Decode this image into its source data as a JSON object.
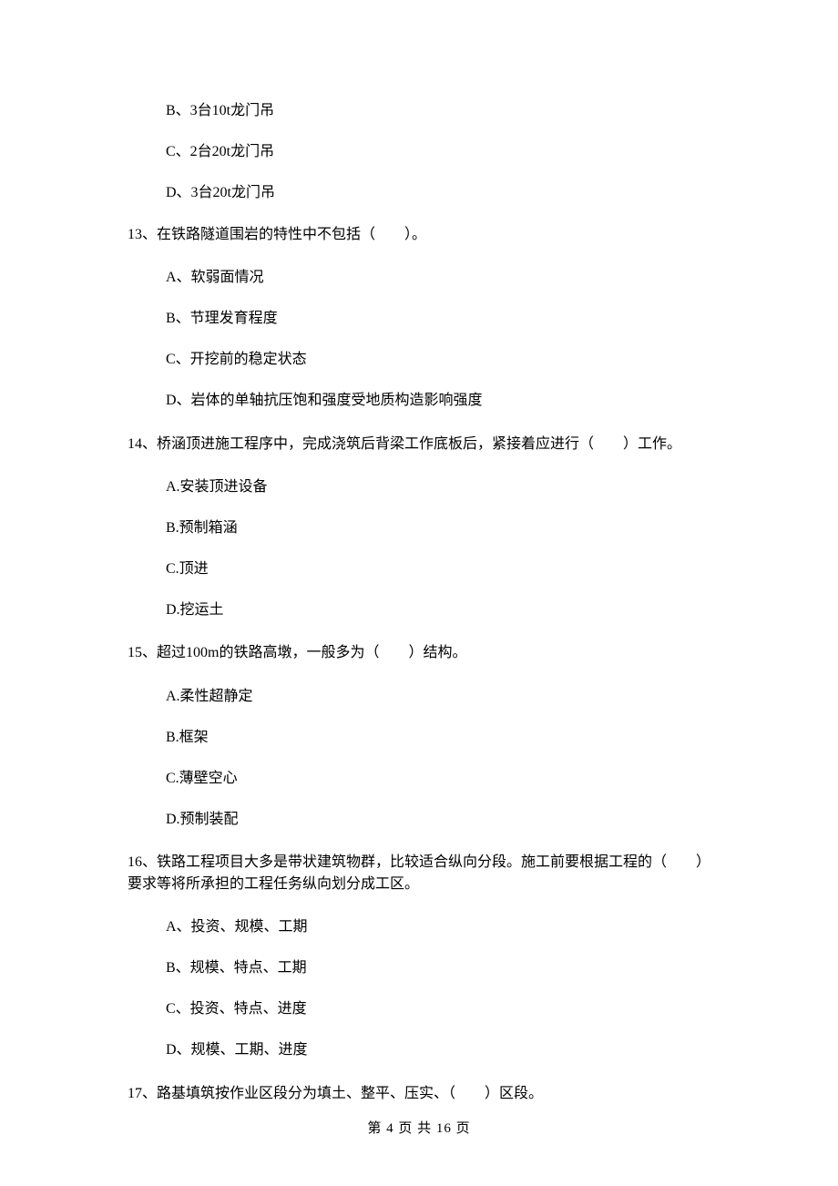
{
  "orphan_options": {
    "b": "B、3台10t龙门吊",
    "c": "C、2台20t龙门吊",
    "d": "D、3台20t龙门吊"
  },
  "q13": {
    "text": "13、在铁路隧道围岩的特性中不包括（　　）。",
    "a": "A、软弱面情况",
    "b": "B、节理发育程度",
    "c": "C、开挖前的稳定状态",
    "d": "D、岩体的单轴抗压饱和强度受地质构造影响强度"
  },
  "q14": {
    "text": "14、桥涵顶进施工程序中，完成浇筑后背梁工作底板后，紧接着应进行（　　）工作。",
    "a": "A.安装顶进设备",
    "b": "B.预制箱涵",
    "c": "C.顶进",
    "d": "D.挖运土"
  },
  "q15": {
    "text": "15、超过100m的铁路高墩，一般多为（　　）结构。",
    "a": "A.柔性超静定",
    "b": "B.框架",
    "c": "C.薄壁空心",
    "d": "D.预制装配"
  },
  "q16": {
    "text": "16、铁路工程项目大多是带状建筑物群，比较适合纵向分段。施工前要根据工程的（　　）要求等将所承担的工程任务纵向划分成工区。",
    "a": "A、投资、规模、工期",
    "b": "B、规模、特点、工期",
    "c": "C、投资、特点、进度",
    "d": "D、规模、工期、进度"
  },
  "q17": {
    "text": "17、路基填筑按作业区段分为填土、整平、压实、（　　）区段。"
  },
  "footer": "第 4 页 共 16 页"
}
